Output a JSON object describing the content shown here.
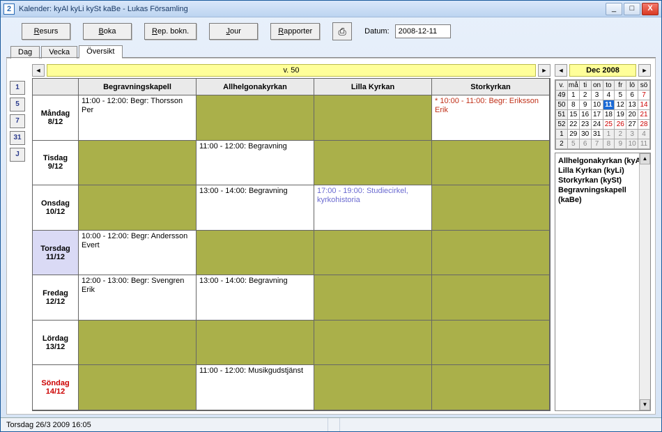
{
  "window": {
    "icon_text": "2",
    "title": "Kalender: kyAl kyLi kySt kaBe  - Lukas Församling",
    "min": "_",
    "max": "□",
    "close": "X"
  },
  "toolbar": {
    "resurs": "Resurs",
    "boka": "Boka",
    "rep": "Rep. bokn.",
    "jour": "Jour",
    "rapporter": "Rapporter",
    "print_icon": "⎙",
    "datum_label": "Datum:",
    "datum_value": "2008-12-11"
  },
  "tabs": {
    "dag": "Dag",
    "vecka": "Vecka",
    "oversikt": "Översikt"
  },
  "sidebuttons": {
    "b1": "1",
    "b5": "5",
    "b7": "7",
    "b31": "31",
    "bj": "J"
  },
  "weekbar": {
    "prev": "◄",
    "label": "v. 50",
    "next": "►"
  },
  "columns": [
    "Begravningskapell",
    "Allhelgonakyrkan",
    "Lilla Kyrkan",
    "Storkyrkan"
  ],
  "days": [
    {
      "name": "Måndag",
      "date": "8/12",
      "today": false,
      "sun": false,
      "cells": [
        {
          "olive": false,
          "text": "11:00 - 12:00: Begr: Thorsson Per",
          "style": ""
        },
        {
          "olive": true,
          "text": "",
          "style": ""
        },
        {
          "olive": true,
          "text": "",
          "style": ""
        },
        {
          "olive": false,
          "text": "* 10:00 - 11:00: Begr: Eriksson Erik",
          "style": "red"
        }
      ]
    },
    {
      "name": "Tisdag",
      "date": "9/12",
      "today": false,
      "sun": false,
      "cells": [
        {
          "olive": true,
          "text": "",
          "style": ""
        },
        {
          "olive": false,
          "text": "11:00 - 12:00: Begravning",
          "style": ""
        },
        {
          "olive": true,
          "text": "",
          "style": ""
        },
        {
          "olive": true,
          "text": "",
          "style": ""
        }
      ]
    },
    {
      "name": "Onsdag",
      "date": "10/12",
      "today": false,
      "sun": false,
      "cells": [
        {
          "olive": true,
          "text": "",
          "style": ""
        },
        {
          "olive": false,
          "text": "13:00 - 14:00: Begravning",
          "style": ""
        },
        {
          "olive": false,
          "text": "17:00 - 19:00: Studiecirkel, kyrkohistoria",
          "style": "blue"
        },
        {
          "olive": true,
          "text": "",
          "style": ""
        }
      ]
    },
    {
      "name": "Torsdag",
      "date": "11/12",
      "today": true,
      "sun": false,
      "cells": [
        {
          "olive": false,
          "text": "10:00 - 12:00: Begr: Andersson Evert",
          "style": ""
        },
        {
          "olive": true,
          "text": "",
          "style": ""
        },
        {
          "olive": true,
          "text": "",
          "style": ""
        },
        {
          "olive": true,
          "text": "",
          "style": ""
        }
      ]
    },
    {
      "name": "Fredag",
      "date": "12/12",
      "today": false,
      "sun": false,
      "cells": [
        {
          "olive": false,
          "text": "12:00 - 13:00: Begr: Svengren Erik",
          "style": ""
        },
        {
          "olive": false,
          "text": "13:00 - 14:00: Begravning",
          "style": ""
        },
        {
          "olive": true,
          "text": "",
          "style": ""
        },
        {
          "olive": true,
          "text": "",
          "style": ""
        }
      ]
    },
    {
      "name": "Lördag",
      "date": "13/12",
      "today": false,
      "sun": false,
      "cells": [
        {
          "olive": true,
          "text": "",
          "style": ""
        },
        {
          "olive": true,
          "text": "",
          "style": ""
        },
        {
          "olive": true,
          "text": "",
          "style": ""
        },
        {
          "olive": true,
          "text": "",
          "style": ""
        }
      ]
    },
    {
      "name": "Söndag",
      "date": "14/12",
      "today": false,
      "sun": true,
      "cells": [
        {
          "olive": true,
          "text": "",
          "style": ""
        },
        {
          "olive": false,
          "text": "11:00 - 12:00: Musikgudstjänst",
          "style": ""
        },
        {
          "olive": true,
          "text": "",
          "style": ""
        },
        {
          "olive": true,
          "text": "",
          "style": ""
        }
      ]
    }
  ],
  "month": {
    "prev": "◄",
    "label": "Dec 2008",
    "next": "►"
  },
  "calendar": {
    "dow": [
      "v.",
      "må",
      "ti",
      "on",
      "to",
      "fr",
      "lö",
      "sö"
    ],
    "rows": [
      {
        "wk": "49",
        "d": [
          {
            "t": "1"
          },
          {
            "t": "2"
          },
          {
            "t": "3"
          },
          {
            "t": "4"
          },
          {
            "t": "5"
          },
          {
            "t": "6"
          },
          {
            "t": "7",
            "red": true
          }
        ]
      },
      {
        "wk": "50",
        "d": [
          {
            "t": "8"
          },
          {
            "t": "9"
          },
          {
            "t": "10"
          },
          {
            "t": "11",
            "today": true
          },
          {
            "t": "12"
          },
          {
            "t": "13"
          },
          {
            "t": "14",
            "red": true
          }
        ]
      },
      {
        "wk": "51",
        "d": [
          {
            "t": "15"
          },
          {
            "t": "16"
          },
          {
            "t": "17"
          },
          {
            "t": "18"
          },
          {
            "t": "19"
          },
          {
            "t": "20"
          },
          {
            "t": "21",
            "red": true
          }
        ]
      },
      {
        "wk": "52",
        "d": [
          {
            "t": "22"
          },
          {
            "t": "23"
          },
          {
            "t": "24"
          },
          {
            "t": "25",
            "red": true
          },
          {
            "t": "26",
            "red": true
          },
          {
            "t": "27"
          },
          {
            "t": "28",
            "red": true
          }
        ]
      },
      {
        "wk": "1",
        "d": [
          {
            "t": "29"
          },
          {
            "t": "30"
          },
          {
            "t": "31"
          },
          {
            "t": "1",
            "dim": true
          },
          {
            "t": "2",
            "dim": true
          },
          {
            "t": "3",
            "dim": true
          },
          {
            "t": "4",
            "dim": true
          }
        ]
      },
      {
        "wk": "2",
        "d": [
          {
            "t": "5",
            "dim": true
          },
          {
            "t": "6",
            "dim": true
          },
          {
            "t": "7",
            "dim": true
          },
          {
            "t": "8",
            "dim": true
          },
          {
            "t": "9",
            "dim": true
          },
          {
            "t": "10",
            "dim": true
          },
          {
            "t": "11",
            "dim": true
          }
        ]
      }
    ]
  },
  "resources": [
    {
      "name": "Allhelgonakyrkan",
      "code": "(kyAl)"
    },
    {
      "name": "Lilla Kyrkan",
      "code": "(kyLi)"
    },
    {
      "name": "Storkyrkan",
      "code": "(kySt)"
    },
    {
      "name": "Begravningskapell",
      "code": "(kaBe)"
    }
  ],
  "status": {
    "text": "Torsdag 26/3 2009  16:05"
  }
}
